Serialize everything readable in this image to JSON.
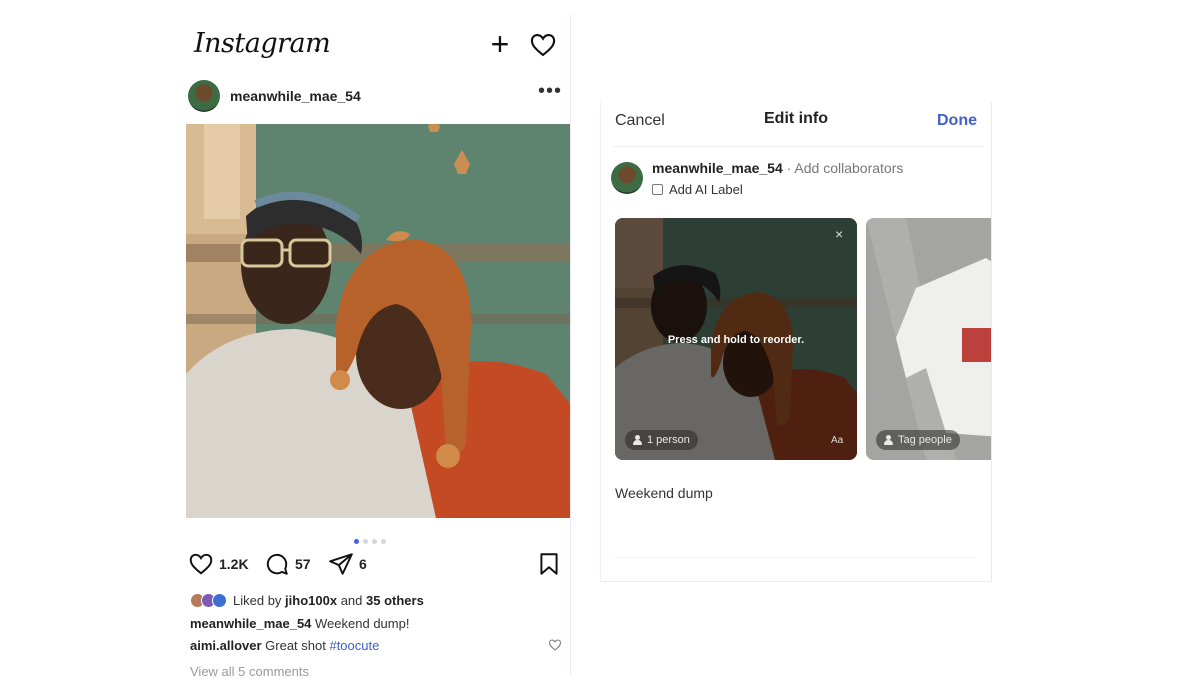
{
  "feed": {
    "logo": "Instagram",
    "post": {
      "username": "meanwhile_mae_54",
      "more_label": "•••",
      "likes_count": "1.2K",
      "comments_count": "57",
      "shares_count": "6",
      "liked_by_prefix": "Liked by ",
      "liked_by_user": "jiho100x",
      "liked_by_and": " and ",
      "liked_by_others": "35 others",
      "caption_user": "meanwhile_mae_54",
      "caption_text": " Weekend dump!",
      "comment_user": "aimi.allover",
      "comment_text": " Great shot ",
      "comment_hashtag": "#toocute",
      "view_all": "View all 5 comments",
      "carousel_dots": 4,
      "active_dot": 1
    }
  },
  "edit_panel": {
    "cancel": "Cancel",
    "title": "Edit info",
    "done": "Done",
    "username": "meanwhile_mae_54",
    "separator": " · ",
    "add_collaborators": "Add collaborators",
    "add_ai_label": "Add AI Label",
    "reorder_hint": "Press and hold to reorder.",
    "close_label": "×",
    "people_tag": "1 person",
    "text_label": "Aa",
    "tag_people": "Tag people",
    "caption": "Weekend dump"
  },
  "colors": {
    "accent_blue": "#3f5fc9",
    "dot_active": "#4a5fe0"
  },
  "icons": {
    "new_post": "plus-icon",
    "notifications": "heart-icon",
    "like": "heart-outline-icon",
    "comment": "speech-bubble-icon",
    "share": "paper-plane-icon",
    "save": "bookmark-icon"
  }
}
